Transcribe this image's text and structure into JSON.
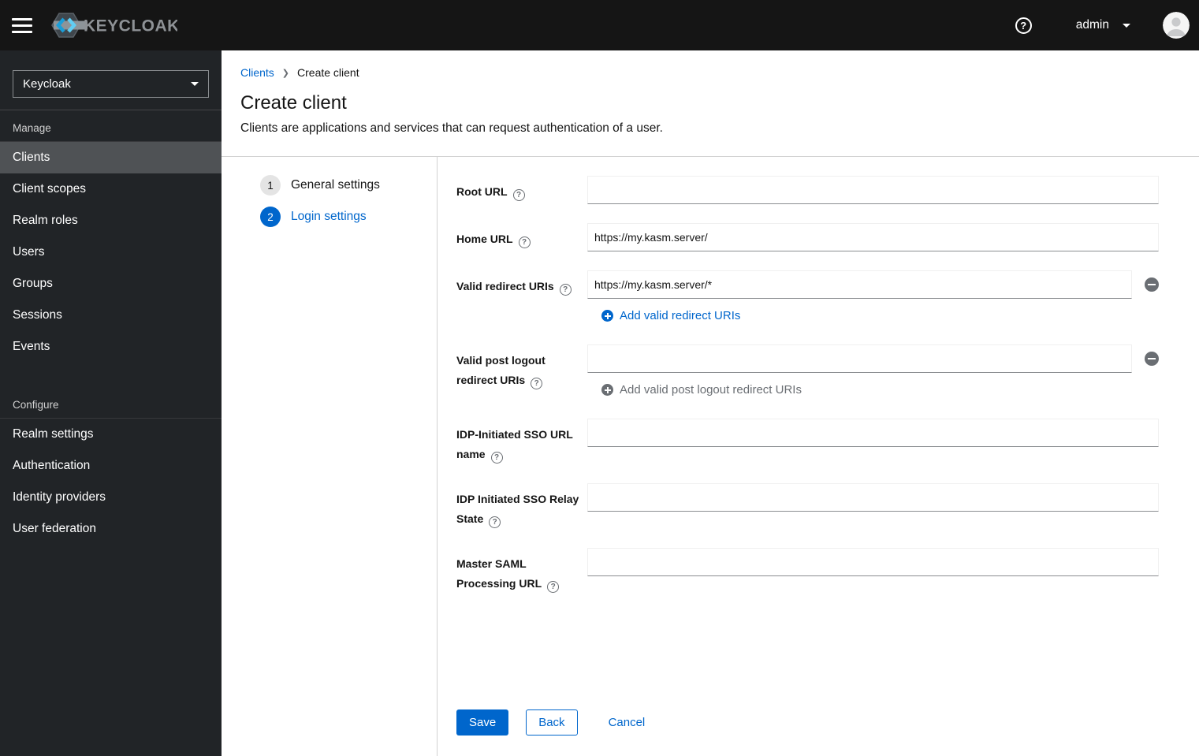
{
  "colors": {
    "primary": "#0066cc",
    "topbar_bg": "#151515",
    "sidebar_bg": "#212427",
    "sidebar_active_bg": "#4f5255",
    "icon_gray": "#6a6e73"
  },
  "topbar": {
    "brand": "KEYCLOAK",
    "user_name": "admin"
  },
  "sidebar": {
    "realm_selector": {
      "value": "Keycloak"
    },
    "sections": [
      {
        "label": "Manage",
        "items": [
          {
            "label": "Clients",
            "active": true
          },
          {
            "label": "Client scopes",
            "active": false
          },
          {
            "label": "Realm roles",
            "active": false
          },
          {
            "label": "Users",
            "active": false
          },
          {
            "label": "Groups",
            "active": false
          },
          {
            "label": "Sessions",
            "active": false
          },
          {
            "label": "Events",
            "active": false
          }
        ]
      },
      {
        "label": "Configure",
        "items": [
          {
            "label": "Realm settings",
            "active": false
          },
          {
            "label": "Authentication",
            "active": false
          },
          {
            "label": "Identity providers",
            "active": false
          },
          {
            "label": "User federation",
            "active": false
          }
        ]
      }
    ]
  },
  "breadcrumb": [
    {
      "label": "Clients",
      "link": true
    },
    {
      "label": "Create client",
      "link": false
    }
  ],
  "page": {
    "title": "Create client",
    "description": "Clients are applications and services that can request authentication of a user."
  },
  "wizard": {
    "steps": [
      {
        "number": "1",
        "label": "General settings",
        "active": false
      },
      {
        "number": "2",
        "label": "Login settings",
        "active": true
      }
    ]
  },
  "form": {
    "fields": [
      {
        "label": "Root URL",
        "value": "",
        "help": true
      },
      {
        "label": "Home URL",
        "value": "https://my.kasm.server/",
        "help": true
      },
      {
        "label": "Valid redirect URIs",
        "value": "https://my.kasm.server/*",
        "help": true,
        "removable": true,
        "add_label": "Add valid redirect URIs",
        "add_disabled": false
      },
      {
        "label": "Valid post logout redirect URIs",
        "value": "",
        "help": true,
        "removable": true,
        "add_label": "Add valid post logout redirect URIs",
        "add_disabled": true
      },
      {
        "label": "IDP-Initiated SSO URL name",
        "value": "",
        "help": true
      },
      {
        "label": "IDP Initiated SSO Relay State",
        "value": "",
        "help": true
      },
      {
        "label": "Master SAML Processing URL",
        "value": "",
        "help": true
      }
    ],
    "actions": {
      "save": "Save",
      "back": "Back",
      "cancel": "Cancel"
    }
  }
}
